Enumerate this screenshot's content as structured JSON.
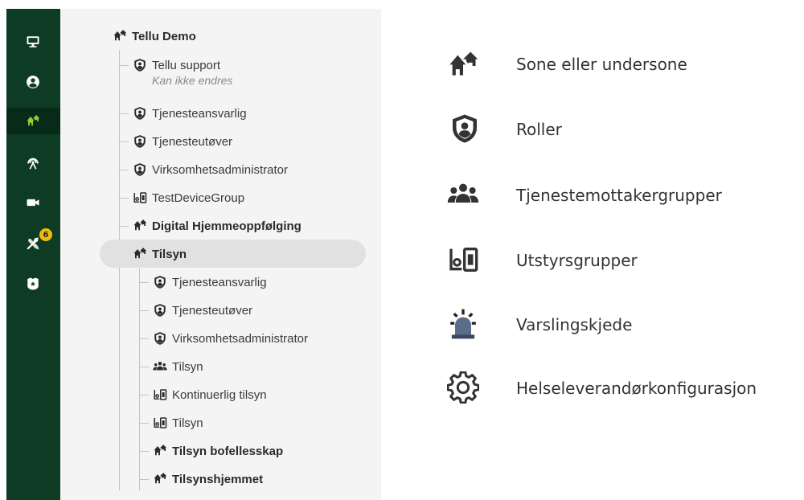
{
  "sidebar": {
    "items": [
      {
        "name": "monitor-icon"
      },
      {
        "name": "user-icon"
      },
      {
        "name": "zones-icon",
        "active": true
      },
      {
        "name": "sensor-icon"
      },
      {
        "name": "video-icon"
      },
      {
        "name": "tools-icon",
        "badge": "6"
      },
      {
        "name": "police-badge-icon"
      }
    ],
    "background": "#0d3b24",
    "accent": "#9acd32"
  },
  "tree": {
    "root": "Tellu Demo",
    "items": [
      {
        "label": "Tellu support",
        "sub": "Kan ikke endres",
        "icon": "role-icon"
      },
      {
        "label": "Tjenesteansvarlig",
        "icon": "role-icon"
      },
      {
        "label": "Tjenesteutøver",
        "icon": "role-icon"
      },
      {
        "label": "Virksomhetsadministrator",
        "icon": "role-icon"
      },
      {
        "label": "TestDeviceGroup",
        "icon": "device-group-icon"
      },
      {
        "label": "Digital Hjemmeoppfølging",
        "icon": "zone-icon",
        "bold": true
      },
      {
        "label": "Tilsyn",
        "icon": "zone-icon",
        "bold": true,
        "selected": true
      }
    ],
    "tilsyn_children": [
      {
        "label": "Tjenesteansvarlig",
        "icon": "role-icon"
      },
      {
        "label": "Tjenesteutøver",
        "icon": "role-icon"
      },
      {
        "label": "Virksomhetsadministrator",
        "icon": "role-icon"
      },
      {
        "label": "Tilsyn",
        "icon": "recipient-group-icon"
      },
      {
        "label": "Kontinuerlig tilsyn",
        "icon": "device-group-icon"
      },
      {
        "label": "Tilsyn",
        "icon": "device-group-icon"
      },
      {
        "label": "Tilsyn bofellesskap",
        "icon": "zone-icon",
        "bold": true
      },
      {
        "label": "Tilsynshjemmet",
        "icon": "zone-icon",
        "bold": true
      }
    ]
  },
  "legend": {
    "items": [
      {
        "label": "Sone eller undersone",
        "icon": "zone-icon"
      },
      {
        "label": "Roller",
        "icon": "role-icon"
      },
      {
        "label": "Tjenestemottakergrupper",
        "icon": "recipient-group-icon"
      },
      {
        "label": "Utstyrsgrupper",
        "icon": "device-group-icon"
      },
      {
        "label": "Varslingskjede",
        "icon": "alarm-light-icon"
      },
      {
        "label": "Helseleverandørkonfigurasjon",
        "icon": "gear-icon"
      }
    ]
  }
}
